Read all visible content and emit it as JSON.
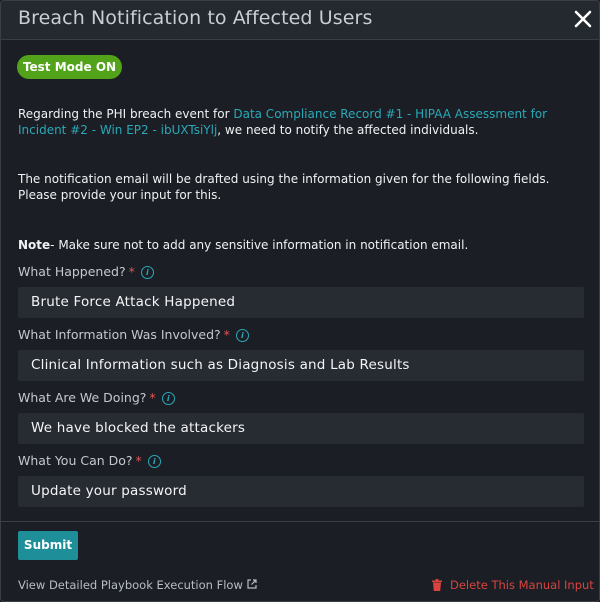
{
  "dialog": {
    "title": "Breach Notification to Affected Users",
    "close_icon": "close-icon"
  },
  "badge": {
    "label": "Test Mode ON",
    "color": "#52a31a"
  },
  "intro": {
    "prefix": "Regarding the PHI breach event for ",
    "link_text": "Data Compliance Record #1 - HIPAA Assessment for Incident #2 - Win EP2 - ibUXTsiYlj",
    "suffix": ", we need to notify the affected individuals."
  },
  "instructions": "The notification email will be drafted using the information given for the following fields. Please provide your input for this.",
  "note": {
    "label": "Note",
    "text": "- Make sure not to add any sensitive information in notification email."
  },
  "fields": [
    {
      "label": "What Happened?",
      "required": "*",
      "value": "Brute Force Attack Happened"
    },
    {
      "label": "What Information Was Involved?",
      "required": "*",
      "value": "Clinical Information such as Diagnosis and Lab Results"
    },
    {
      "label": "What Are We Doing?",
      "required": "*",
      "value": "We have blocked the attackers"
    },
    {
      "label": "What You Can Do?",
      "required": "*",
      "value": "Update your password"
    }
  ],
  "info_glyph": "i",
  "submit_label": "Submit",
  "footer": {
    "playbook_link": "View Detailed Playbook Execution Flow",
    "external_icon": "external-link-icon",
    "delete_label": "Delete This Manual Input",
    "delete_icon": "trash-icon"
  },
  "colors": {
    "accent": "#29a9b8",
    "submit": "#1e8f99",
    "danger": "#d9443f",
    "required": "#e05555"
  }
}
